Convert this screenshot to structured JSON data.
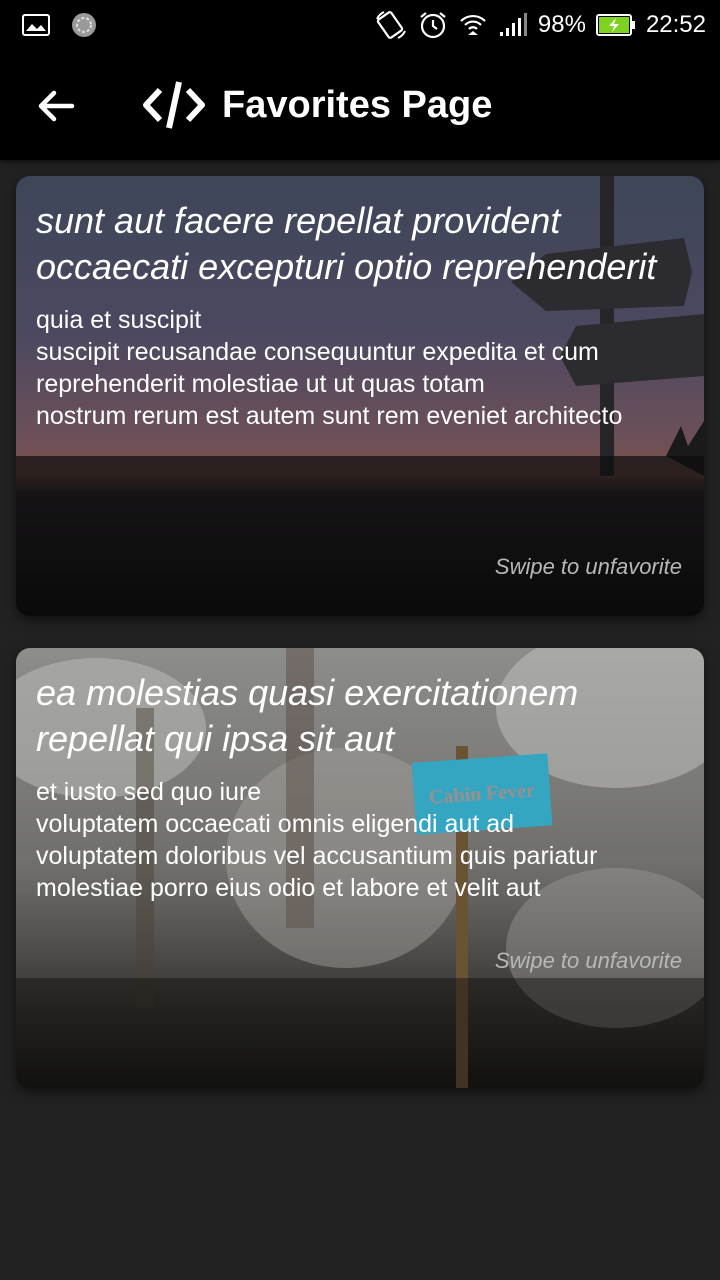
{
  "status_bar": {
    "battery": "98%",
    "time": "22:52",
    "icons": [
      "gallery-icon",
      "sync-icon",
      "rotate-icon",
      "alarm-icon",
      "wifi-icon",
      "signal-icon",
      "battery-charging-icon"
    ]
  },
  "app_bar": {
    "title": "Favorites Page",
    "back_icon": "arrow-back-icon",
    "logo_icon": "code-icon"
  },
  "cards": [
    {
      "title": "sunt aut facere repellat provident occaecati excepturi optio reprehenderit",
      "body": "quia et suscipit\nsuscipit recusandae consequuntur expedita et cum reprehenderit molestiae ut ut quas totam\nnostrum rerum est autem sunt rem eveniet architecto",
      "hint": "Swipe to unfavorite"
    },
    {
      "title": "ea molestias quasi exercitationem repellat qui ipsa sit aut",
      "body": "et iusto sed quo iure\nvoluptatem occaecati omnis eligendi aut ad\nvoluptatem doloribus vel accusantium quis pariatur\nmolestiae porro eius odio et labore et velit aut",
      "hint": "Swipe to unfavorite",
      "sign_text": "Cabin Fever"
    }
  ],
  "colors": {
    "background": "#222222",
    "app_bar": "#000000",
    "battery_fill": "#7ed321"
  }
}
